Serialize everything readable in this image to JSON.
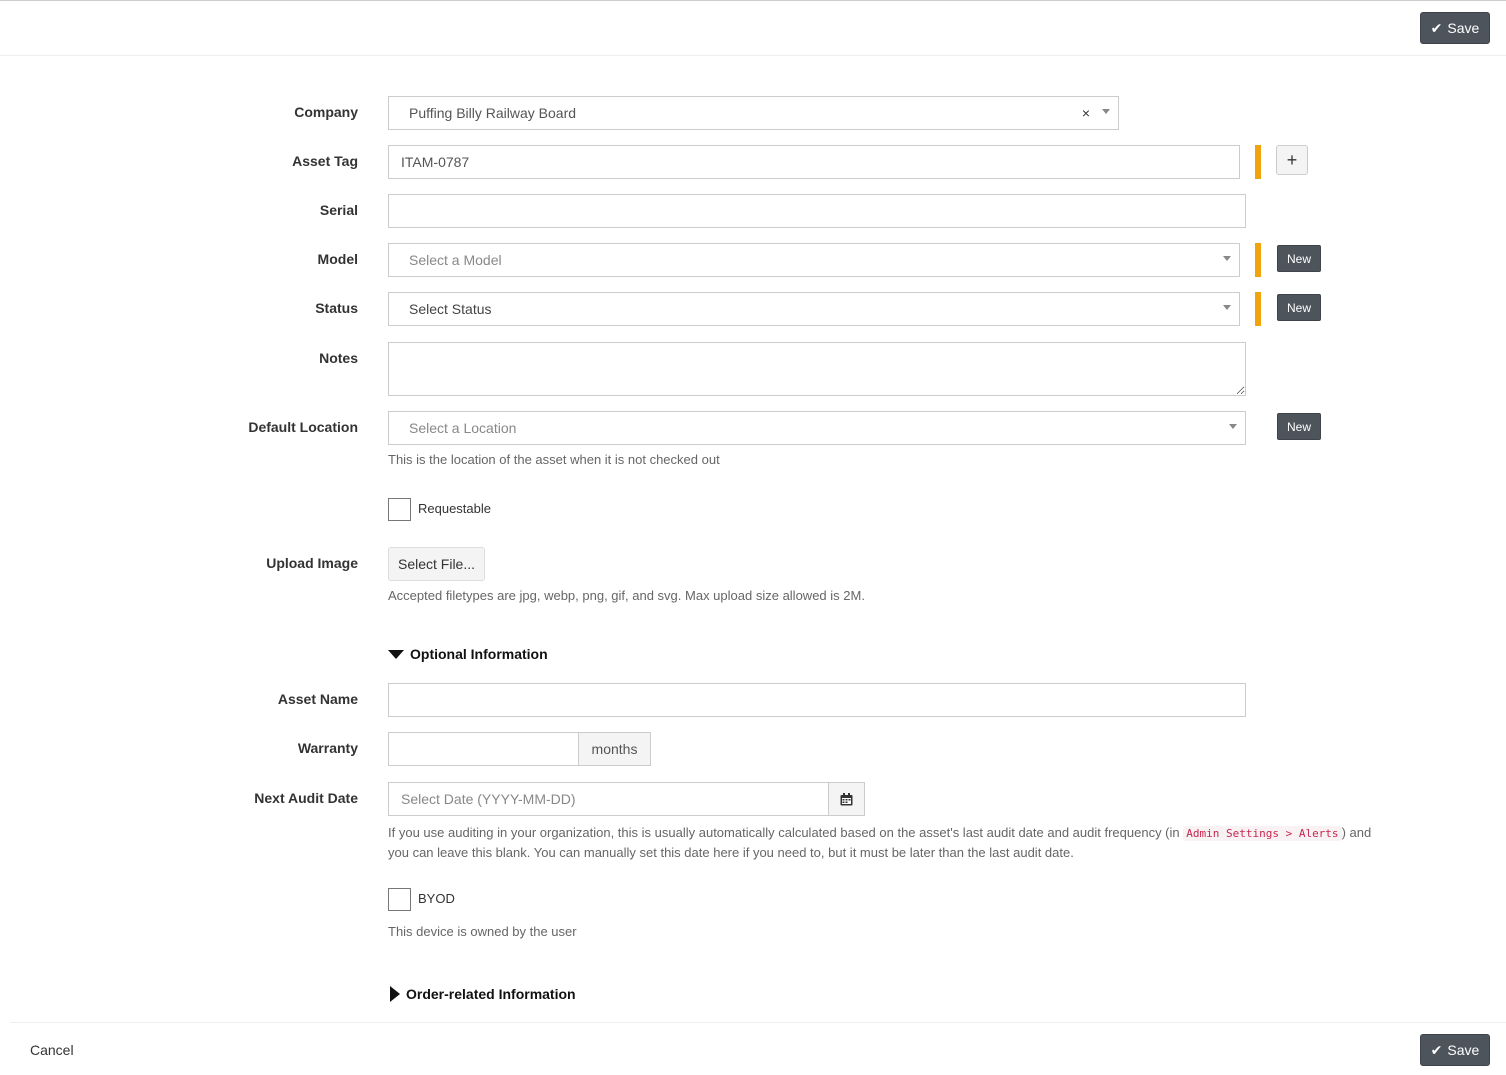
{
  "toolbar": {
    "save_label": "Save"
  },
  "footer": {
    "save_label": "Save",
    "cancel_label": "Cancel"
  },
  "form": {
    "company": {
      "label": "Company",
      "value": "Puffing Billy Railway Board",
      "clear": "×"
    },
    "asset_tag": {
      "label": "Asset Tag",
      "value": "ITAM-0787",
      "add_label": "+"
    },
    "serial": {
      "label": "Serial",
      "value": ""
    },
    "model": {
      "label": "Model",
      "placeholder": "Select a Model",
      "new_label": "New"
    },
    "status": {
      "label": "Status",
      "value": "Select Status",
      "new_label": "New"
    },
    "notes": {
      "label": "Notes",
      "value": ""
    },
    "default_location": {
      "label": "Default Location",
      "placeholder": "Select a Location",
      "new_label": "New",
      "help": "This is the location of the asset when it is not checked out"
    },
    "requestable": {
      "label": "Requestable",
      "checked": false
    },
    "upload_image": {
      "label": "Upload Image",
      "button": "Select File...",
      "help": "Accepted filetypes are jpg, webp, png, gif, and svg. Max upload size allowed is 2M."
    },
    "optional_section": {
      "title": "Optional Information",
      "expanded": true
    },
    "asset_name": {
      "label": "Asset Name",
      "value": ""
    },
    "warranty": {
      "label": "Warranty",
      "value": "",
      "unit": "months"
    },
    "next_audit_date": {
      "label": "Next Audit Date",
      "placeholder": "Select Date (YYYY-MM-DD)",
      "help_before": "If you use auditing in your organization, this is usually automatically calculated based on the asset's last audit date and audit frequency (in ",
      "help_code": "Admin Settings > Alerts",
      "help_after": ") and",
      "help_line2": "you can leave this blank. You can manually set this date here if you need to, but it must be later than the last audit date."
    },
    "byod": {
      "label": "BYOD",
      "checked": false,
      "help": "This device is owned by the user"
    },
    "order_section": {
      "title": "Order-related Information",
      "expanded": false
    }
  },
  "colors": {
    "required_bar": "#f0a30a",
    "button_dark": "#4e545c"
  }
}
